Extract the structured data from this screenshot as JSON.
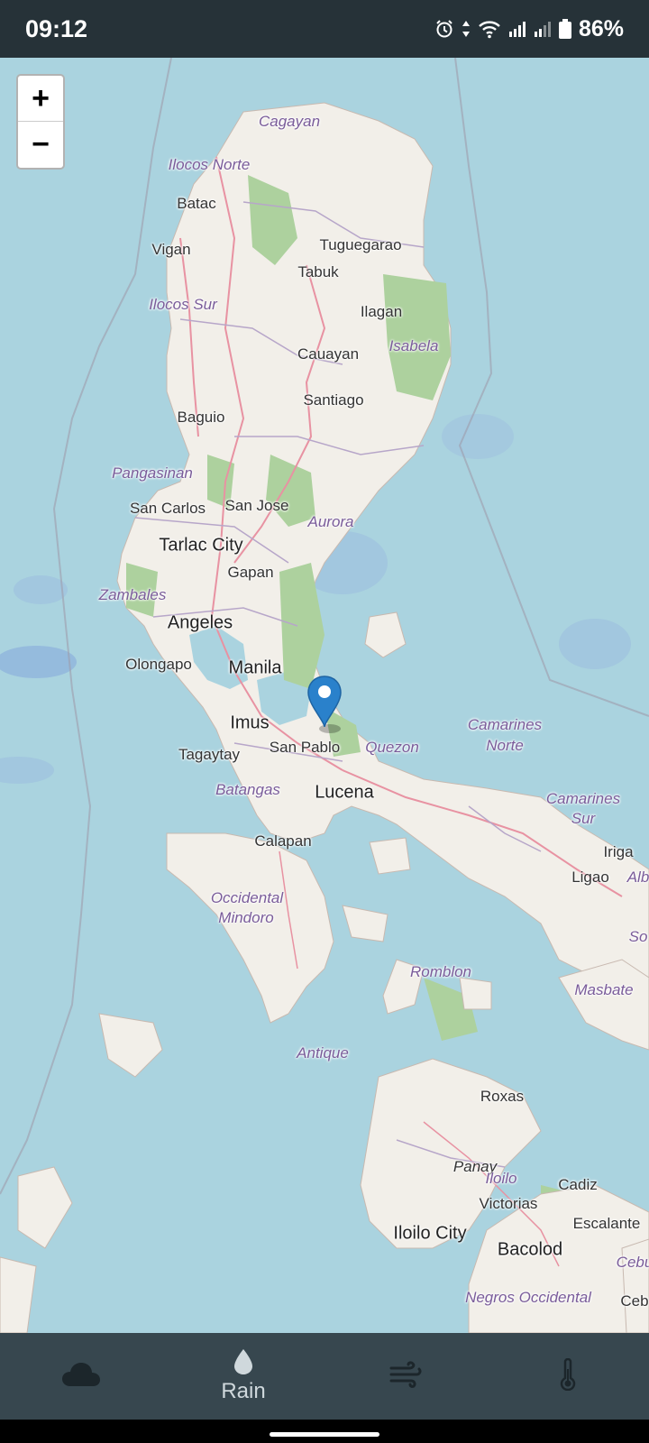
{
  "status_bar": {
    "time": "09:12",
    "battery": "86%",
    "icons": [
      "alarm-icon",
      "data-arrows-icon",
      "wifi-icon",
      "signal-icon",
      "signal-icon",
      "battery-icon"
    ]
  },
  "map": {
    "zoom_in_label": "+",
    "zoom_out_label": "−",
    "marker_icon": "map-pin-icon",
    "colors": {
      "water": "#aad3df",
      "land": "#f2efe9",
      "forest": "#add19e",
      "road": "#e892a2",
      "border": "#9e9cab",
      "region_label": "#7a5c9a"
    },
    "labels": {
      "cagayan": "Cagayan",
      "ilocos_norte": "Ilocos Norte",
      "batac": "Batac",
      "vigan": "Vigan",
      "tuguegarao": "Tuguegarao",
      "tabuk": "Tabuk",
      "ilocos_sur": "Ilocos Sur",
      "ilagan": "Ilagan",
      "isabela": "Isabela",
      "cauayan": "Cauayan",
      "santiago": "Santiago",
      "baguio": "Baguio",
      "pangasinan": "Pangasinan",
      "san_carlos": "San Carlos",
      "san_jose": "San Jose",
      "aurora": "Aurora",
      "tarlac_city": "Tarlac City",
      "gapan": "Gapan",
      "zambales": "Zambales",
      "angeles": "Angeles",
      "olongapo": "Olongapo",
      "manila": "Manila",
      "imus": "Imus",
      "tagaytay": "Tagaytay",
      "san_pablo": "San Pablo",
      "quezon": "Quezon",
      "camarines_norte_1": "Camarines",
      "camarines_norte_2": "Norte",
      "batangas": "Batangas",
      "lucena": "Lucena",
      "camarines_sur_1": "Camarines",
      "camarines_sur_2": "Sur",
      "calapan": "Calapan",
      "iriga": "Iriga",
      "ligao": "Ligao",
      "alb": "Alb",
      "occidental_mindoro_1": "Occidental",
      "occidental_mindoro_2": "Mindoro",
      "so": "So",
      "romblon": "Romblon",
      "masbate": "Masbate",
      "antique": "Antique",
      "roxas": "Roxas",
      "panay": "Panay",
      "iloilo": "Iloilo",
      "cadiz": "Cadiz",
      "victorias": "Victorias",
      "escalante": "Escalante",
      "iloilo_city": "Iloilo City",
      "bacolod": "Bacolod",
      "cebu": "Cebu",
      "negros_occidental": "Negros Occidental",
      "ceb": "Ceb"
    }
  },
  "bottom_nav": {
    "items": [
      {
        "icon": "cloud-icon",
        "label": ""
      },
      {
        "icon": "raindrop-icon",
        "label": "Rain"
      },
      {
        "icon": "wind-icon",
        "label": ""
      },
      {
        "icon": "thermometer-icon",
        "label": ""
      }
    ]
  }
}
